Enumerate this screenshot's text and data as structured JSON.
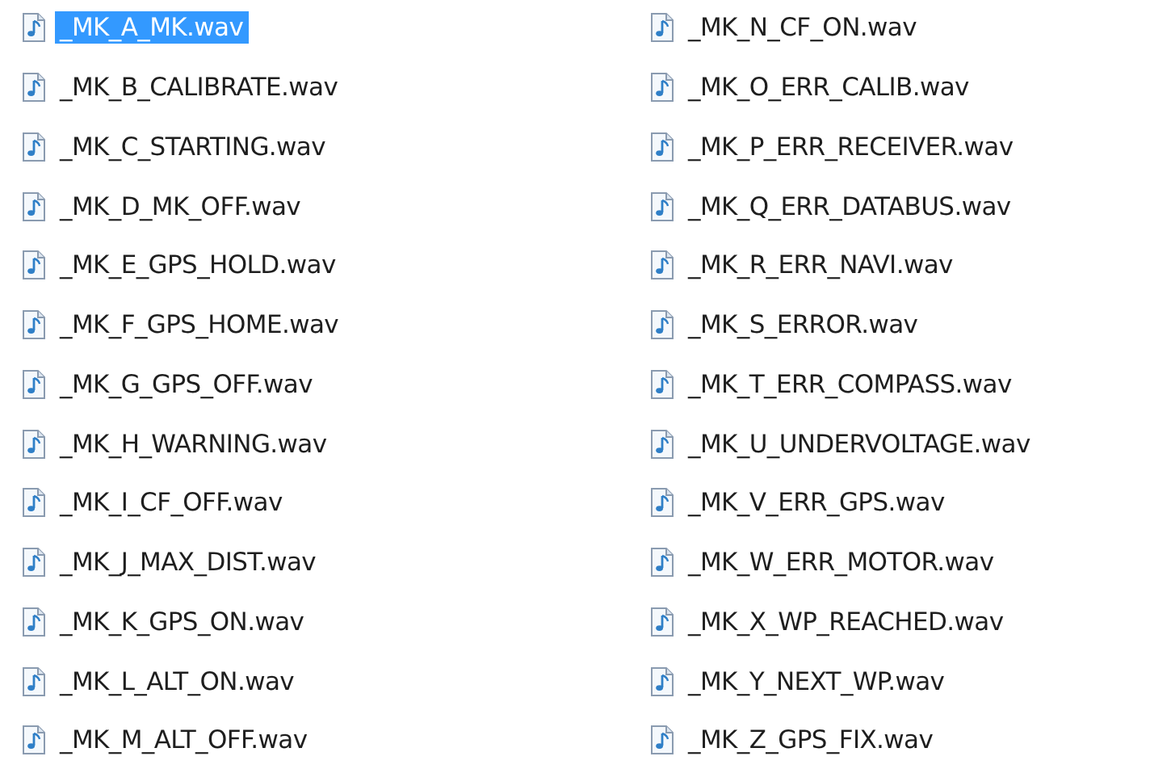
{
  "files": [
    {
      "name": "_MK_A_MK.wav",
      "selected": true
    },
    {
      "name": "_MK_B_CALIBRATE.wav",
      "selected": false
    },
    {
      "name": "_MK_C_STARTING.wav",
      "selected": false
    },
    {
      "name": "_MK_D_MK_OFF.wav",
      "selected": false
    },
    {
      "name": "_MK_E_GPS_HOLD.wav",
      "selected": false
    },
    {
      "name": "_MK_F_GPS_HOME.wav",
      "selected": false
    },
    {
      "name": "_MK_G_GPS_OFF.wav",
      "selected": false
    },
    {
      "name": "_MK_H_WARNING.wav",
      "selected": false
    },
    {
      "name": "_MK_I_CF_OFF.wav",
      "selected": false
    },
    {
      "name": "_MK_J_MAX_DIST.wav",
      "selected": false
    },
    {
      "name": "_MK_K_GPS_ON.wav",
      "selected": false
    },
    {
      "name": "_MK_L_ALT_ON.wav",
      "selected": false
    },
    {
      "name": "_MK_M_ALT_OFF.wav",
      "selected": false
    },
    {
      "name": "_MK_N_CF_ON.wav",
      "selected": false
    },
    {
      "name": "_MK_O_ERR_CALIB.wav",
      "selected": false
    },
    {
      "name": "_MK_P_ERR_RECEIVER.wav",
      "selected": false
    },
    {
      "name": "_MK_Q_ERR_DATABUS.wav",
      "selected": false
    },
    {
      "name": "_MK_R_ERR_NAVI.wav",
      "selected": false
    },
    {
      "name": "_MK_S_ERROR.wav",
      "selected": false
    },
    {
      "name": "_MK_T_ERR_COMPASS.wav",
      "selected": false
    },
    {
      "name": "_MK_U_UNDERVOLTAGE.wav",
      "selected": false
    },
    {
      "name": "_MK_V_ERR_GPS.wav",
      "selected": false
    },
    {
      "name": "_MK_W_ERR_MOTOR.wav",
      "selected": false
    },
    {
      "name": "_MK_X_WP_REACHED.wav",
      "selected": false
    },
    {
      "name": "_MK_Y_NEXT_WP.wav",
      "selected": false
    },
    {
      "name": "_MK_Z_GPS_FIX.wav",
      "selected": false
    }
  ]
}
